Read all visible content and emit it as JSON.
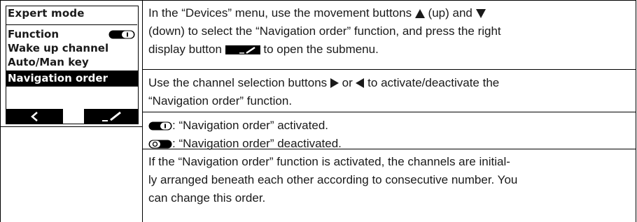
{
  "device_screen": {
    "title": "Expert mode",
    "items": [
      {
        "label": "Function",
        "toggle": "on"
      },
      {
        "label": "Wake up channel"
      },
      {
        "label": "Auto/Man key"
      },
      {
        "label": "Navigation order",
        "selected": true
      }
    ],
    "softkeys": [
      "back-arrow-icon",
      "edit-pen-icon"
    ]
  },
  "instructions": {
    "para1_a": "In the “Devices” menu, use the movement buttons ",
    "para1_b": " (up) and ",
    "para1_c": "(down) to select the “Navigation order” function, and press the right",
    "para1_d": "display button ",
    "para1_e": " to open the submenu.",
    "para2_a": "Use the channel selection buttons ",
    "para2_b": " or ",
    "para2_c": " to activate/deactivate the",
    "para2_d": "“Navigation order” function.",
    "activated": ": “Navigation order” activated.",
    "deactivated": ": “Navigation order” deactivated.",
    "para4_1": "If the “Navigation order” function is activated, the channels are initial-",
    "para4_2": "ly arranged beneath each other according to consecutive number. You",
    "para4_3": "can change this order."
  },
  "colors": {
    "ink": "#000000",
    "text": "#1a1a1a",
    "background": "#ffffff"
  }
}
